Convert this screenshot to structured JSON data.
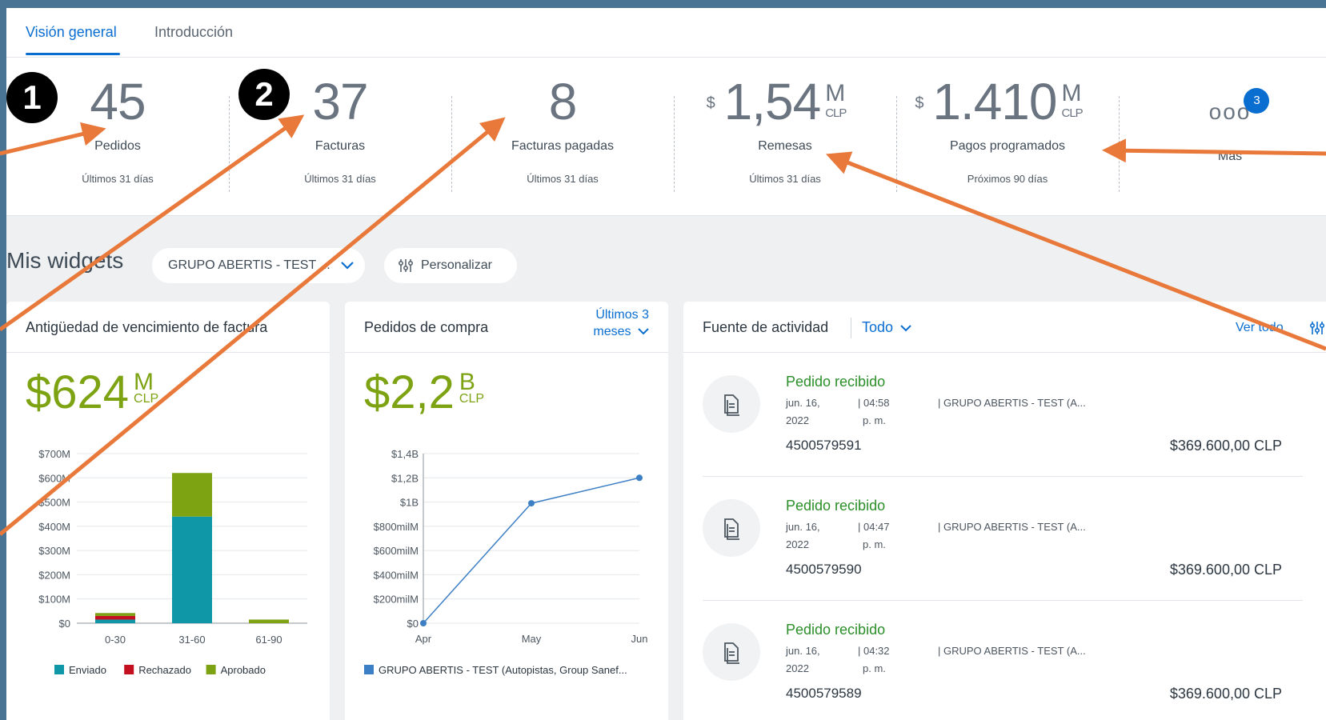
{
  "tabs": [
    {
      "label": "Visión general",
      "active": true
    },
    {
      "label": "Introducción",
      "active": false
    }
  ],
  "kpis": [
    {
      "value": "45",
      "label": "Pedidos",
      "period": "Últimos 31 días"
    },
    {
      "value": "37",
      "label": "Facturas",
      "period": "Últimos 31 días"
    },
    {
      "value": "8",
      "label": "Facturas pagadas",
      "period": "Últimos 31 días"
    },
    {
      "currency": "$",
      "value": "1,54",
      "unit": "M",
      "unit_currency": "CLP",
      "label": "Remesas",
      "period": "Últimos 31 días"
    },
    {
      "currency": "$",
      "value": "1.410",
      "unit": "M",
      "unit_currency": "CLP",
      "label": "Pagos programados",
      "period": "Próximos 90 días"
    }
  ],
  "more": {
    "dots": "ooo",
    "badge": "3",
    "label": "Más"
  },
  "callouts": [
    "1",
    "2"
  ],
  "widgets": {
    "title": "Mis widgets",
    "filter_label": "GRUPO ABERTIS - TEST ...",
    "customize_label": "Personalizar"
  },
  "invoice_aging": {
    "title": "Antigüedad de vencimiento de factura",
    "total": "$624",
    "total_unit": "M",
    "total_currency": "CLP",
    "accent": "#7da313"
  },
  "purchase_orders": {
    "title": "Pedidos de compra",
    "range_label_1": "Últimos 3",
    "range_label_2": "meses",
    "total": "$2,2",
    "total_unit": "B",
    "total_currency": "CLP"
  },
  "activity": {
    "title": "Fuente de actividad",
    "filter": "Todo",
    "see_all": "Ver todo",
    "items": [
      {
        "status": "Pedido recibido",
        "date_1": "jun. 16,",
        "date_2": "2022",
        "time_1": "| 04:58",
        "time_2": "p. m.",
        "org": "| GRUPO ABERTIS - TEST (A...",
        "id": "4500579591",
        "amount": "$369.600,00 CLP"
      },
      {
        "status": "Pedido recibido",
        "date_1": "jun. 16,",
        "date_2": "2022",
        "time_1": "| 04:47",
        "time_2": "p. m.",
        "org": "| GRUPO ABERTIS - TEST (A...",
        "id": "4500579590",
        "amount": "$369.600,00 CLP"
      },
      {
        "status": "Pedido recibido",
        "date_1": "jun. 16,",
        "date_2": "2022",
        "time_1": "| 04:32",
        "time_2": "p. m.",
        "org": "| GRUPO ABERTIS - TEST (A...",
        "id": "4500579589",
        "amount": "$369.600,00 CLP"
      }
    ]
  },
  "colors": {
    "accent": "#0a6ed1",
    "arrow": "#e8793a",
    "status_green": "#2b8f29"
  },
  "chart_data": [
    {
      "type": "bar",
      "stacked": true,
      "categories": [
        "0-30",
        "31-60",
        "61-90"
      ],
      "y_ticks": [
        "$0",
        "$100M",
        "$200M",
        "$300M",
        "$400M",
        "$500M",
        "$600M",
        "$700M"
      ],
      "ylim": [
        0,
        700
      ],
      "series": [
        {
          "name": "Enviado",
          "color": "#0f97a8",
          "values": [
            15,
            440,
            0
          ]
        },
        {
          "name": "Rechazado",
          "color": "#c30f1f",
          "values": [
            15,
            0,
            0
          ]
        },
        {
          "name": "Aprobado",
          "color": "#7da313",
          "values": [
            12,
            180,
            15
          ]
        }
      ],
      "grid": true,
      "legend": "bottom"
    },
    {
      "type": "line",
      "x": [
        "Apr",
        "May",
        "Jun"
      ],
      "y_ticks": [
        "$0",
        "$200milM",
        "$400milM",
        "$600milM",
        "$800milM",
        "$1B",
        "$1,2B",
        "$1,4B"
      ],
      "ylim": [
        0,
        1400
      ],
      "series": [
        {
          "name": "GRUPO ABERTIS - TEST (Autopistas, Group Sanef...",
          "color": "#3d7fc4",
          "values": [
            0,
            990,
            1200
          ]
        }
      ],
      "grid": true,
      "legend": "bottom"
    }
  ]
}
